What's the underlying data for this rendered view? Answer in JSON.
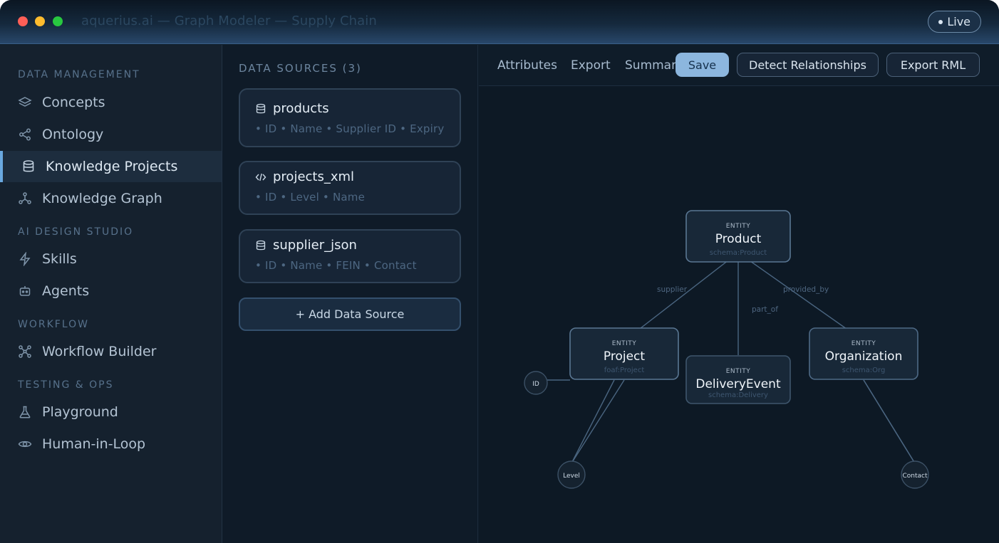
{
  "window": {
    "title": "aquerius.ai — Graph Modeler — Supply Chain",
    "status_badge": "Live"
  },
  "sidebar": {
    "sections": [
      {
        "heading": "DATA MANAGEMENT",
        "items": [
          {
            "label": "Concepts",
            "icon": "layers-icon",
            "active": false
          },
          {
            "label": "Ontology",
            "icon": "share-nodes-icon",
            "active": false
          },
          {
            "label": "Knowledge Projects",
            "icon": "database-icon",
            "active": true
          },
          {
            "label": "Knowledge Graph",
            "icon": "graph-icon",
            "active": false
          }
        ]
      },
      {
        "heading": "AI DESIGN STUDIO",
        "items": [
          {
            "label": "Skills",
            "icon": "bolt-icon",
            "active": false
          },
          {
            "label": "Agents",
            "icon": "robot-icon",
            "active": false
          }
        ]
      },
      {
        "heading": "WORKFLOW",
        "items": [
          {
            "label": "Workflow Builder",
            "icon": "workflow-icon",
            "active": false
          }
        ]
      },
      {
        "heading": "TESTING & OPS",
        "items": [
          {
            "label": "Playground",
            "icon": "flask-icon",
            "active": false
          },
          {
            "label": "Human-in-Loop",
            "icon": "eye-icon",
            "active": false
          }
        ]
      }
    ]
  },
  "data_sources": {
    "heading": "DATA SOURCES (3)",
    "items": [
      {
        "name": "products",
        "icon": "database-icon",
        "fields": "• ID • Name • Supplier ID • Expiry"
      },
      {
        "name": "projects_xml",
        "icon": "code-icon",
        "fields": "• ID • Level • Name"
      },
      {
        "name": "supplier_json",
        "icon": "database-icon",
        "fields": "• ID • Name • FEIN • Contact"
      }
    ],
    "add_label": "+ Add Data Source"
  },
  "toolbar": {
    "tabs": [
      "Attributes",
      "Export",
      "Summary"
    ],
    "save_label": "Save",
    "detect_label": "Detect Relationships",
    "export_rml_label": "Export RML"
  },
  "graph": {
    "entities": [
      {
        "kind": "ENTITY",
        "title": "Product",
        "type": "schema:Product"
      },
      {
        "kind": "ENTITY",
        "title": "Project",
        "type": "foaf:Project"
      },
      {
        "kind": "ENTITY",
        "title": "DeliveryEvent",
        "type": "schema:Delivery"
      },
      {
        "kind": "ENTITY",
        "title": "Organization",
        "type": "schema:Org"
      }
    ],
    "relations": [
      "supplier",
      "part_of",
      "provided_by"
    ],
    "attributes": [
      "ID",
      "Level",
      "Contact"
    ]
  },
  "colors": {
    "accent": "#8cb6de",
    "background": "#0f1c29",
    "node_border": "#5a7793",
    "edge": "#4f6a84"
  }
}
